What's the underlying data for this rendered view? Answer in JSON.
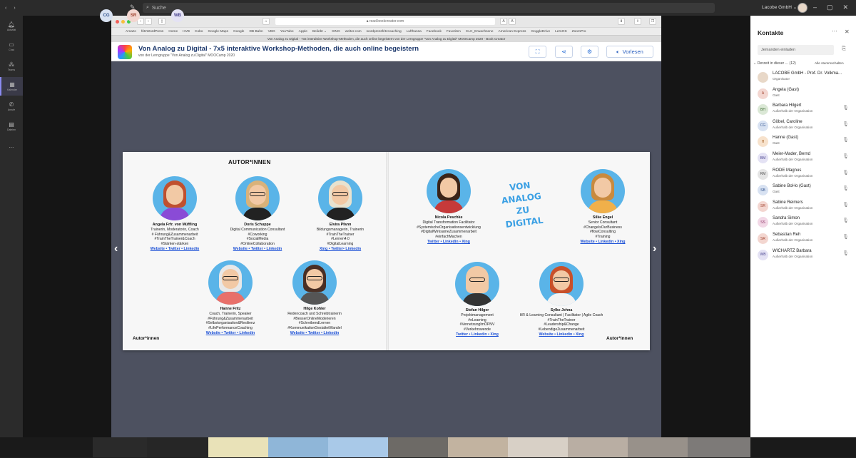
{
  "topbar": {
    "search_placeholder": "Suche",
    "org_name": "Lacobe GmbH ⌄"
  },
  "rail": [
    {
      "label": "Aktivität",
      "icon": "bell-icon"
    },
    {
      "label": "Chat",
      "icon": "chat-icon"
    },
    {
      "label": "Teams",
      "icon": "teams-icon"
    },
    {
      "label": "Kalender",
      "icon": "calendar-icon"
    },
    {
      "label": "Anrufe",
      "icon": "phone-icon"
    },
    {
      "label": "Dateien",
      "icon": "files-icon"
    },
    {
      "label": "...",
      "icon": "more-icon"
    },
    {
      "label": "Apps",
      "icon": "apps-icon"
    },
    {
      "label": "Hilfe",
      "icon": "help-icon"
    }
  ],
  "browser": {
    "url": "read.bookcreator.com",
    "bookmarks": [
      "Amazo",
      "fritzWordPress",
      "Home",
      "HVB",
      "Cobo",
      "Google Maps",
      "Google",
      "DB Bahn",
      "VBG",
      "YouTube",
      "Apple",
      "Beliebt ⌄",
      "XING",
      "welter.com",
      "wordpressfritzcoaching",
      "Lufthansa",
      "Facebook",
      "Favoriten",
      "CLC_Erwachsene",
      "American Express",
      "GoggleDrive",
      "LernOS",
      "ZoomPro"
    ],
    "tab_title": "Von Analog zu Digital - 7x5 interaktive Workshop-Methoden, die auch online begeistern von der Lerngruppe \"Von Analog zu Digital\" MOOCamp 2020 - Book Creator"
  },
  "book": {
    "title": "Von Analog zu Digital - 7x5 interaktive Workshop-Methoden, die auch online begeistern",
    "subtitle": "von der Lerngruppe \"Von Analog zu Digital\" MOOCamp 2020",
    "read_aloud": "Vorlesen",
    "heading": "AUTOR*INNEN",
    "footer_left": "Autor*innen",
    "footer_right": "Autor*innen",
    "logo_text": "VON ANALOG ZU DIGITAL",
    "authors": [
      {
        "name": "Angela Frfr. von Müffling",
        "lines": [
          "Trainerin, Moderatorin, Coach",
          "# Führung&Zusammenarbeit",
          "#TrainTheTrainer&Coach",
          "#Stärken-stärken"
        ],
        "links": "Website • Twitter • Linkedin",
        "hair": "#c0502f",
        "body": "#8a4bd6",
        "glasses": false
      },
      {
        "name": "Doris Schuppe",
        "lines": [
          "Digital Communication Consultant",
          "#Coworking",
          "#SocialMedia",
          "#OnlineCollaboration"
        ],
        "links": "Website • Twitter • Linkedin",
        "hair": "#d9b27a",
        "body": "#222222",
        "glasses": true
      },
      {
        "name": "Elvira Pfann",
        "lines": [
          "Bildungsmanagerin, Trainerin",
          "#TrainTheTrainer",
          "#Lernen4.0",
          "#DigitalLearning"
        ],
        "links": "Xing • Twitter• Linkedin",
        "hair": "#e8e2cf",
        "body": "#222222",
        "glasses": true
      },
      {
        "name": "Hanne Fritz",
        "lines": [
          "Coach, Trainerin, Speaker",
          "#Führung&Zusammenarbeit",
          "#Selbstorganisation&Resilienz",
          "#LifePerformanceCoaching"
        ],
        "links": "Website • Twitter • Linkedin",
        "hair": "#e8e8e8",
        "body": "#e8706a",
        "glasses": true
      },
      {
        "name": "Hilge Kohler",
        "lines": [
          "Redencoach und Schreibtrainerin",
          "#BesserOnlineModerieren",
          "#SchreibendLernen",
          "#KommunikationGestaltetWandel"
        ],
        "links": "Website • Twitter • Linkedin",
        "hair": "#4a2f24",
        "body": "#555555",
        "glasses": true
      },
      {
        "name": "Nicola Peschke",
        "lines": [
          "Digital Transformation Facilitator",
          "#SystemischeOrganisationsentwicklung",
          "#DigitalWirksameZusammenarbeit",
          "#einfachMachen"
        ],
        "links": "Twitter • Linkedin • Xing",
        "hair": "#3b2418",
        "body": "#c63a3a",
        "glasses": false
      },
      {
        "name": "Silke Engel",
        "lines": [
          "Senior Consultant",
          "#ChangeIsOurBusiness",
          "#flowConsulting",
          "#Training"
        ],
        "links": "Website • Linkedin • Xing",
        "hair": "#c98a3e",
        "body": "#f0b04a",
        "glasses": false
      },
      {
        "name": "Stefan Hilger",
        "lines": [
          "Projektmanagement",
          "#eLearning",
          "#VernetzungImÖPNV",
          "#Verkehrswende"
        ],
        "links": "Twitter • Linkedin • Xing",
        "hair": "#f2c9a5",
        "body": "#333333",
        "glasses": true
      },
      {
        "name": "Sylke Jehna",
        "lines": [
          "HR & Learning Consultant | Facilitator | Agile Coach",
          "#TrainTheTrainer",
          "#Leadership&Change",
          "#LebendigeZusammenarbeit"
        ],
        "links": "Website • Linkedin • Xing",
        "hair": "#c8502a",
        "body": "#f3f3f3",
        "glasses": true
      }
    ]
  },
  "panel": {
    "title": "Kontakte",
    "invite_placeholder": "Jemanden einladen",
    "group_label": "⌄ Derzeit in dieser ... (12)",
    "mute_all": "Alle stummschalten",
    "members": [
      {
        "initials": "",
        "name": "LACOBE GmbH - Prof. Dr. Volkma...",
        "status": "Organisator",
        "color": "#e8d8c8",
        "fg": "#333"
      },
      {
        "initials": "A",
        "name": "Angela (Gast)",
        "status": "Gast",
        "color": "#f3d6d0",
        "fg": "#a0402c"
      },
      {
        "initials": "BH",
        "name": "Barbara Hilgert",
        "status": "Außerhalb der Organisation",
        "color": "#dbe8d6",
        "fg": "#3c6b33"
      },
      {
        "initials": "CG",
        "name": "Göbel, Caroline",
        "status": "Außerhalb der Organisation",
        "color": "#d8e2f2",
        "fg": "#33558f"
      },
      {
        "initials": "H",
        "name": "Hanne (Gast)",
        "status": "Gast",
        "color": "#f7e2cc",
        "fg": "#a05a1c"
      },
      {
        "initials": "BM",
        "name": "Meier-Mader, Bernd",
        "status": "Außerhalb der Organisation",
        "color": "#e4e2f4",
        "fg": "#4a4590"
      },
      {
        "initials": "RM",
        "name": "RODE Magnus",
        "status": "Außerhalb der Organisation",
        "color": "#e4e4e4",
        "fg": "#555"
      },
      {
        "initials": "SB",
        "name": "Sabine BoHo (Gast)",
        "status": "Gast",
        "color": "#d8e2f2",
        "fg": "#33558f"
      },
      {
        "initials": "SR",
        "name": "Sabine Reimers",
        "status": "Außerhalb der Organisation",
        "color": "#f3d6d0",
        "fg": "#a0402c"
      },
      {
        "initials": "SS",
        "name": "Sandra Simon",
        "status": "Außerhalb der Organisation",
        "color": "#f2d8e6",
        "fg": "#8f3366"
      },
      {
        "initials": "SR",
        "name": "Sebastian Reh",
        "status": "Außerhalb der Organisation",
        "color": "#f3d6d0",
        "fg": "#a0402c"
      },
      {
        "initials": "WB",
        "name": "WICHARTZ Barbara",
        "status": "Außerhalb der Organisation",
        "color": "#e4e2f4",
        "fg": "#4a4590"
      }
    ]
  },
  "bottom": {
    "avatars": [
      {
        "initials": "CG"
      },
      {
        "initials": "SR"
      },
      {
        "initials": "WB"
      }
    ]
  }
}
